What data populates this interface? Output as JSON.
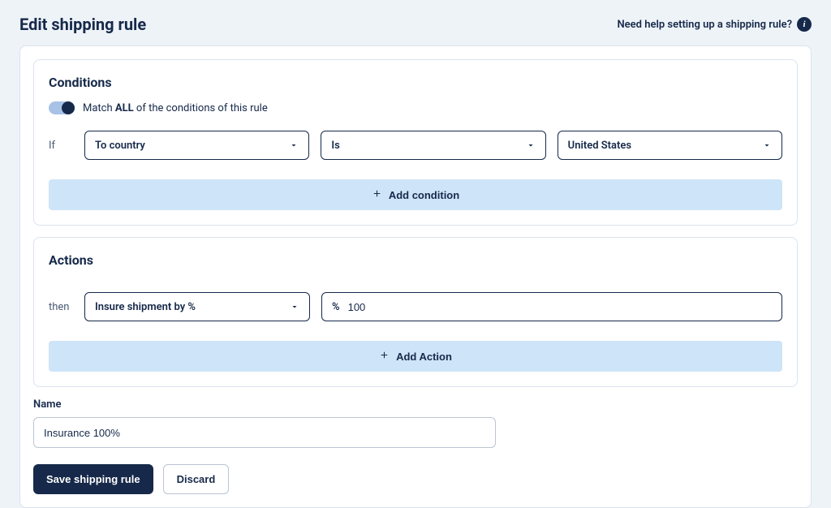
{
  "header": {
    "title": "Edit shipping rule",
    "help_text": "Need help setting up a shipping rule?"
  },
  "conditions": {
    "title": "Conditions",
    "match_prefix": "Match ",
    "match_mode": "ALL",
    "match_suffix": " of the conditions of this rule",
    "row_label": "If",
    "field": "To country",
    "operator": "Is",
    "value": "United States",
    "add_label": "Add condition"
  },
  "actions": {
    "title": "Actions",
    "row_label": "then",
    "action_type": "Insure shipment by %",
    "value_prefix": "%",
    "value": "100",
    "add_label": "Add Action"
  },
  "name_section": {
    "label": "Name",
    "value": "Insurance 100%"
  },
  "footer": {
    "save": "Save shipping rule",
    "discard": "Discard"
  }
}
